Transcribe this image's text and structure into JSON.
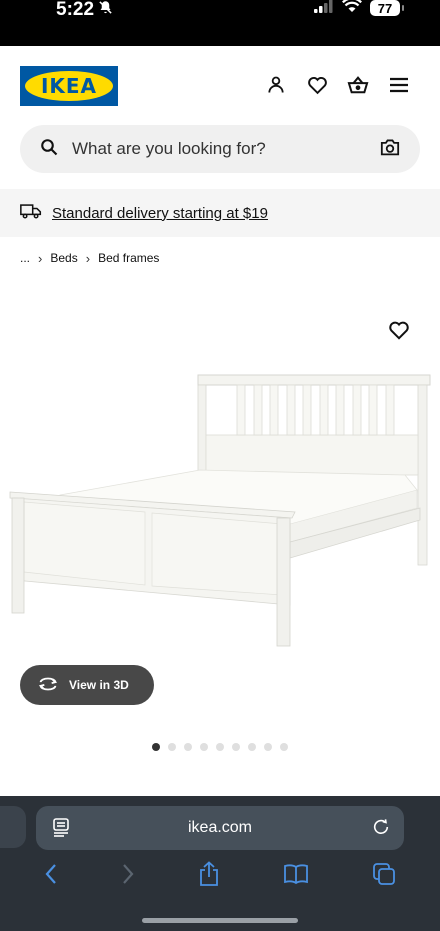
{
  "status": {
    "time": "5:22",
    "battery": "77"
  },
  "header": {
    "logo_text": "IKEA"
  },
  "search": {
    "placeholder": "What are you looking for?"
  },
  "delivery": {
    "text": "Standard delivery starting at $19"
  },
  "breadcrumb": {
    "ellipsis": "...",
    "items": [
      "Beds",
      "Bed frames"
    ]
  },
  "product": {
    "view3d_label": "View in 3D",
    "image_count": 9,
    "active_image": 1
  },
  "browser": {
    "url": "ikea.com"
  },
  "colors": {
    "ikea_blue": "#0058a3",
    "ikea_yellow": "#ffdb00",
    "browser_bg": "#2b3138",
    "browser_icon": "#4a90e2"
  }
}
